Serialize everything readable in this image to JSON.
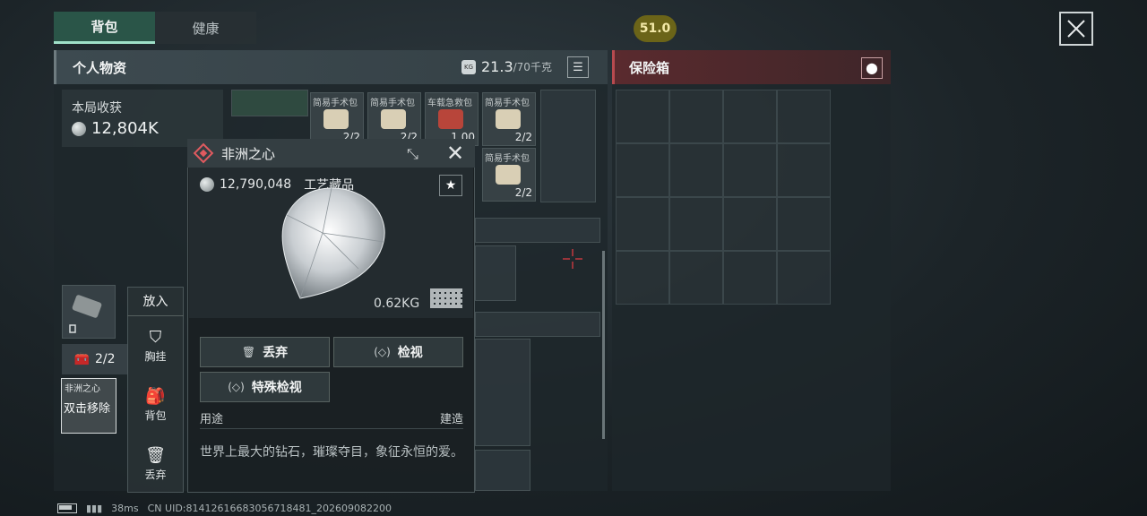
{
  "tabs": [
    {
      "label": "背包",
      "active": true
    },
    {
      "label": "健康",
      "active": false
    }
  ],
  "timer": "51.0",
  "personal": {
    "title": "个人物资",
    "weight": "21.3",
    "weight_max": "/70千克",
    "weight_icon": "KG"
  },
  "safebox": {
    "title": "保险箱"
  },
  "earnings": {
    "label": "本局收获",
    "value": "12,804K"
  },
  "inventory": [
    {
      "label": "简易手术包",
      "count": "2/2",
      "color": "cream"
    },
    {
      "label": "简易手术包",
      "count": "2/2",
      "color": "cream"
    },
    {
      "label": "车载急救包",
      "count": "1.00",
      "color": "red"
    },
    {
      "label": "简易手术包",
      "count": "2/2",
      "color": "cream"
    },
    {
      "label": "简易手术包",
      "count": "2/2",
      "color": "cream"
    }
  ],
  "popup": {
    "title": "非洲之心",
    "price": "12,790,048",
    "category": "工艺藏品",
    "weight": "0.62KG",
    "buttons": {
      "discard": "丢弃",
      "inspect": "检视",
      "special_inspect": "特殊检视"
    },
    "use_label": "用途",
    "build_label": "建造",
    "description": "世界上最大的钻石，璀璨夺目，象征永恒的爱。"
  },
  "side_menu": {
    "header": "放入",
    "items": [
      {
        "label": "胸挂",
        "icon": "vest-icon"
      },
      {
        "label": "背包",
        "icon": "backpack-icon"
      },
      {
        "label": "丢弃",
        "icon": "trash-icon"
      }
    ]
  },
  "left_items": {
    "count": "2/2",
    "selected_label": "非洲之心",
    "selected_hint": "双击移除"
  },
  "status": {
    "ping": "38ms",
    "uid": "CN UID:8141261668305671848​1_202609082200"
  }
}
